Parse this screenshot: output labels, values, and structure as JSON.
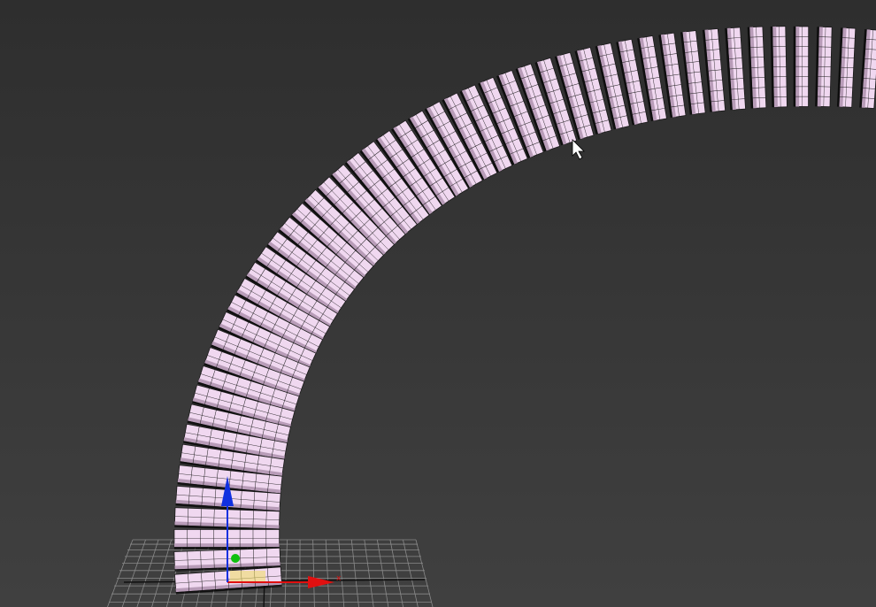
{
  "viewport": {
    "background_top": "#2e2e2e",
    "background_bottom": "#404040"
  },
  "object": {
    "type": "segmented-tube",
    "color": "#f0d8f0",
    "shade": "#b89cb8",
    "edge_color": "#1a1a1a",
    "segments": 52
  },
  "grid": {
    "color": "#8a8a8a",
    "axis_color": "#101010"
  },
  "gizmo": {
    "x_axis": {
      "label": "x",
      "color": "#e01010"
    },
    "y_axis": {
      "label": "y",
      "color": "#10c010"
    },
    "z_axis": {
      "label": "z",
      "color": "#1030e0"
    },
    "plane_color": "#f0e060"
  },
  "cursor": {
    "icon": "arrow-cursor-icon"
  }
}
